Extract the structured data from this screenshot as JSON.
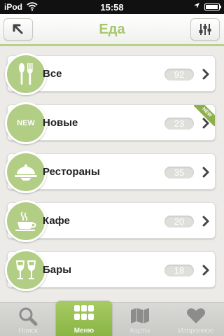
{
  "status_bar": {
    "carrier": "iPod",
    "time": "15:58"
  },
  "header": {
    "title": "Еда"
  },
  "categories": [
    {
      "label": "Все",
      "count": "92",
      "icon": "cutlery-icon"
    },
    {
      "label": "Новые",
      "count": "23",
      "icon": "new-badge-icon",
      "icon_text": "NEW",
      "ribbon": "NEW"
    },
    {
      "label": "Рестораны",
      "count": "35",
      "icon": "cloche-icon"
    },
    {
      "label": "Кафе",
      "count": "20",
      "icon": "coffee-cup-icon"
    },
    {
      "label": "Бары",
      "count": "18",
      "icon": "wine-glasses-icon"
    }
  ],
  "tabbar": [
    {
      "label": "Поиск",
      "icon": "search-icon",
      "active": false
    },
    {
      "label": "Меню",
      "icon": "grid-icon",
      "active": true
    },
    {
      "label": "Карты",
      "icon": "map-icon",
      "active": false
    },
    {
      "label": "Избранное",
      "icon": "heart-icon",
      "active": false
    }
  ],
  "colors": {
    "accent": "#a6c672",
    "icon_circle": "#b2cd84",
    "active_tab": "#96be50"
  }
}
